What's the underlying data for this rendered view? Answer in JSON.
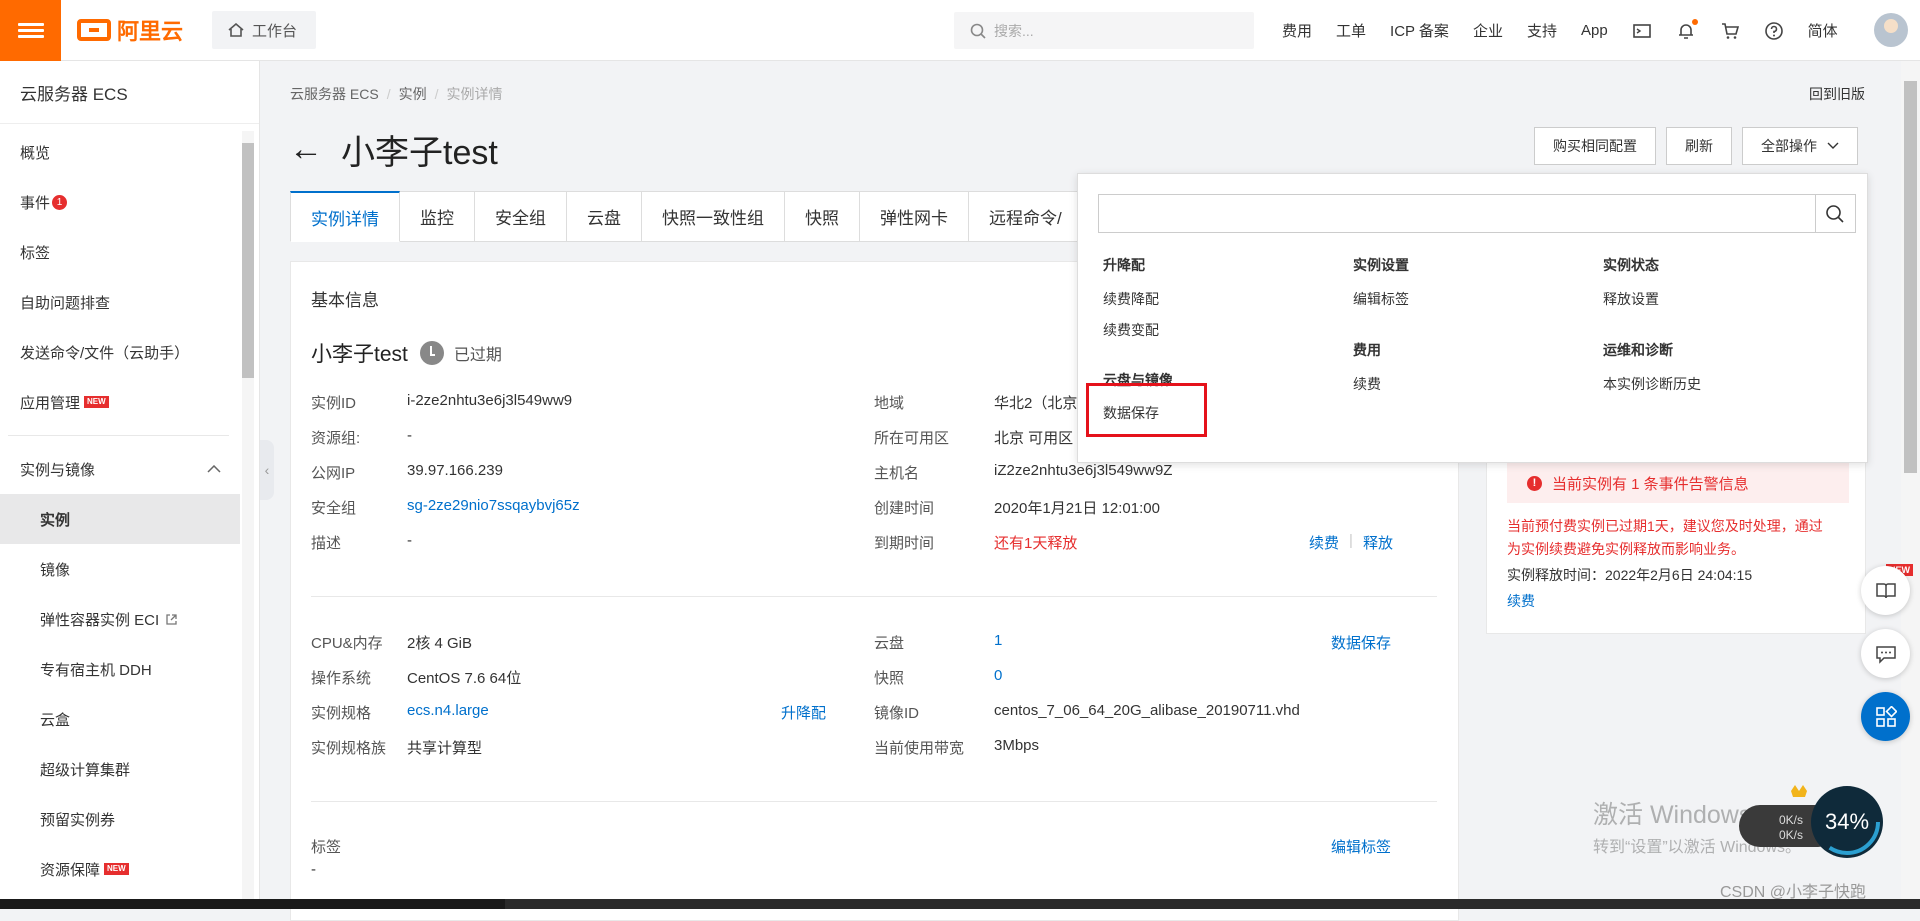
{
  "header": {
    "brand": "阿里云",
    "workbench_label": "工作台",
    "search_placeholder": "搜索...",
    "nav": [
      "费用",
      "工单",
      "ICP 备案",
      "企业",
      "支持",
      "App"
    ],
    "lang": "简体"
  },
  "sidebar": {
    "title": "云服务器 ECS",
    "items": [
      {
        "label": "概览"
      },
      {
        "label": "事件",
        "badge": "1"
      },
      {
        "label": "标签"
      },
      {
        "label": "自助问题排查"
      },
      {
        "label": "发送命令/文件（云助手）"
      },
      {
        "label": "应用管理",
        "tag": "NEW"
      }
    ],
    "group": "实例与镜像",
    "sub_items": [
      {
        "label": "实例"
      },
      {
        "label": "镜像"
      },
      {
        "label": "弹性容器实例 ECI"
      },
      {
        "label": "专有宿主机 DDH"
      },
      {
        "label": "云盒"
      },
      {
        "label": "超级计算集群"
      },
      {
        "label": "预留实例券"
      },
      {
        "label": "资源保障",
        "tag": "NEW"
      }
    ]
  },
  "breadcrumb": [
    "云服务器 ECS",
    "实例",
    "实例详情"
  ],
  "old_version": "回到旧版",
  "page": {
    "back_icon": "←",
    "title": "小李子test",
    "buttons": {
      "buy_same": "购买相同配置",
      "refresh": "刷新",
      "all_ops": "全部操作"
    }
  },
  "tabs": [
    "实例详情",
    "监控",
    "安全组",
    "云盘",
    "快照一致性组",
    "快照",
    "弹性网卡",
    "远程命令/"
  ],
  "basic": {
    "section_title": "基本信息",
    "instance_name": "小李子test",
    "status": "已过期",
    "left": [
      {
        "label": "实例ID",
        "value": "i-2ze2nhtu3e6j3l549ww9"
      },
      {
        "label": "资源组:",
        "value": "-"
      },
      {
        "label": "公网IP",
        "value": "39.97.166.239"
      },
      {
        "label": "安全组",
        "value": "sg-2ze29nio7ssqaybvj65z"
      },
      {
        "label": "描述",
        "value": "-"
      }
    ],
    "right": [
      {
        "label": "地域",
        "value": "华北2（北京"
      },
      {
        "label": "所在可用区",
        "value": "北京 可用区"
      },
      {
        "label": "主机名",
        "value": "iZ2ze2nhtu3e6j3l549ww9Z"
      },
      {
        "label": "创建时间",
        "value": "2020年1月21日 12:01:00"
      },
      {
        "label": "到期时间",
        "value": "还有1天释放"
      }
    ],
    "renew": "续费",
    "release": "释放",
    "config_left": [
      {
        "label": "CPU&内存",
        "value": "2核 4 GiB"
      },
      {
        "label": "操作系统",
        "value": "CentOS 7.6 64位"
      },
      {
        "label": "实例规格",
        "value": "ecs.n4.large"
      },
      {
        "label": "实例规格族",
        "value": "共享计算型"
      }
    ],
    "upgrade": "升降配",
    "config_right": [
      {
        "label": "云盘",
        "value": "1"
      },
      {
        "label": "快照",
        "value": "0"
      },
      {
        "label": "镜像ID",
        "value": "centos_7_06_64_20G_alibase_20190711.vhd"
      },
      {
        "label": "当前使用带宽",
        "value": "3Mbps"
      }
    ],
    "data_save": "数据保存",
    "tags_label": "标签",
    "tags_value": "-",
    "edit_tags": "编辑标签"
  },
  "right_panel": {
    "alert": "当前实例有 1 条事件告警信息",
    "warning_line1": "当前预付费实例已过期1天，建议您及时处理，通过",
    "warning_line2": "为实例续费避免实例释放而影响业务。",
    "release_time": "实例释放时间：2022年2月6日 24:04:15",
    "renew": "续费"
  },
  "dropdown": {
    "groups": [
      {
        "title": "升降配",
        "options": [
          "续费降配",
          "续费变配"
        ]
      },
      {
        "title": "云盘与镜像",
        "options": [
          "数据保存"
        ]
      },
      {
        "title": "实例设置",
        "options": [
          "编辑标签"
        ]
      },
      {
        "title": "费用",
        "options": [
          "续费"
        ]
      },
      {
        "title": "实例状态",
        "options": [
          "释放设置"
        ]
      },
      {
        "title": "运维和诊断",
        "options": [
          "本实例诊断历史"
        ]
      }
    ]
  },
  "float": {
    "new_tag": "NEW"
  },
  "watermark": {
    "line1": "激活 Windows",
    "line2": "转到“设置”以激活 Windows。"
  },
  "speed": {
    "up": "0K/s",
    "down": "0K/s",
    "percent": "34%"
  },
  "csdn": "CSDN @小李子快跑",
  "colors": {
    "brand": "#ff6a00",
    "link": "#0070cc",
    "danger": "#e62e2e"
  }
}
